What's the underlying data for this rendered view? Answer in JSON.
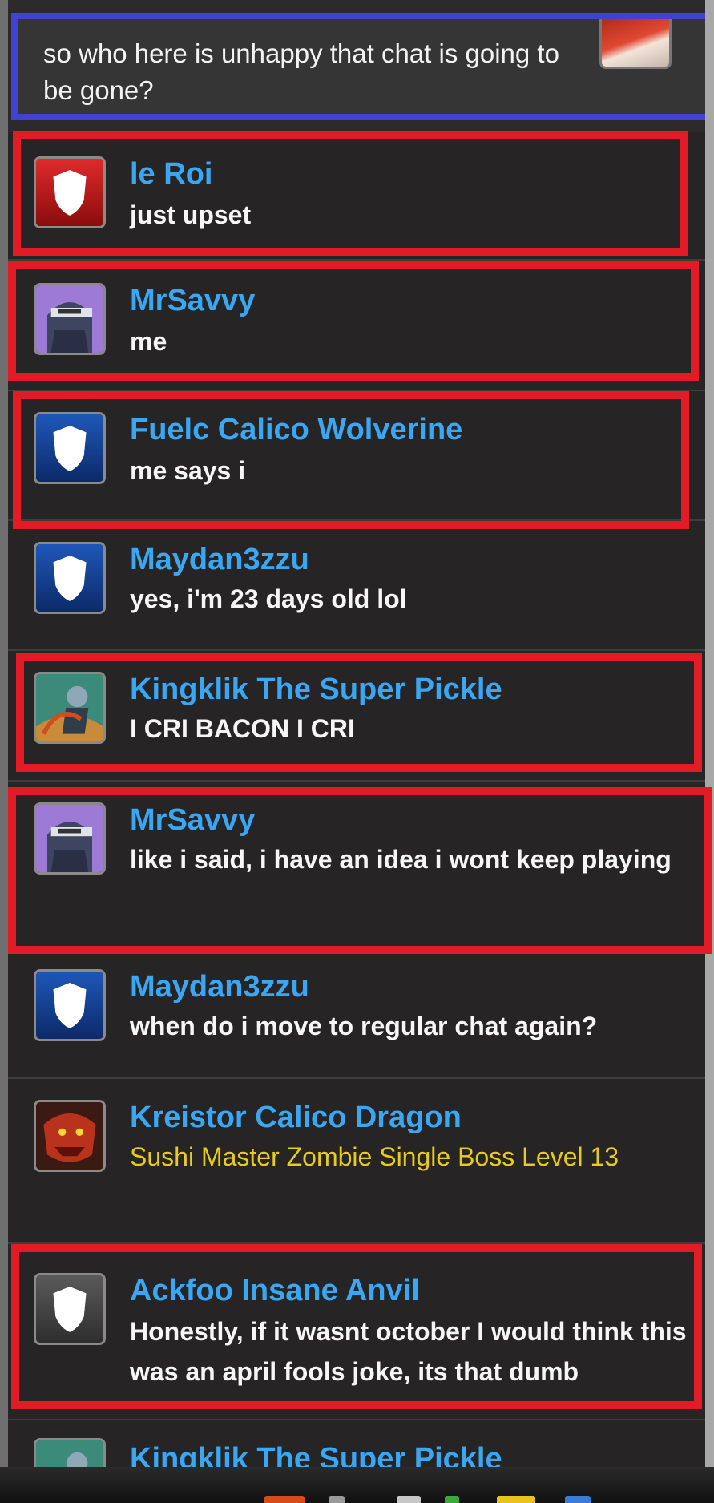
{
  "pinned": {
    "text": "so who here is unhappy that chat is going to be gone?"
  },
  "messages": [
    {
      "user": "le Roi",
      "text": "just upset",
      "avatar": "red-shield"
    },
    {
      "user": "MrSavvy",
      "text": "me",
      "avatar": "ninja"
    },
    {
      "user": "Fuelc Calico Wolverine",
      "text": "me says i",
      "avatar": "blue-shield"
    },
    {
      "user": "Maydan3zzu",
      "text": "yes, i'm 23 days old lol",
      "avatar": "blue-shield"
    },
    {
      "user": "Kingklik The Super Pickle",
      "text": "I CRI BACON I CRI",
      "avatar": "archer"
    },
    {
      "user": "MrSavvy",
      "text": "like i said, i have an idea i wont keep playing",
      "avatar": "ninja"
    },
    {
      "user": "Maydan3zzu",
      "text": "when do i move to regular chat again?",
      "avatar": "blue-shield"
    },
    {
      "user": "Kreistor Calico Dragon",
      "text": "Sushi Master Zombie Single Boss Level 13",
      "avatar": "dragon"
    },
    {
      "user": "Ackfoo Insane Anvil",
      "text": "Honestly, if it wasnt october I would think this was an april fools joke, its that dumb",
      "avatar": "grey-shield"
    },
    {
      "user": "Kingklik The Super Pickle",
      "text": "",
      "avatar": "archer"
    }
  ],
  "colors": {
    "username": "#3aa7f2",
    "system_text": "#e8cc1d",
    "highlight_red": "#e21b27",
    "highlight_blue": "#4142d1"
  }
}
